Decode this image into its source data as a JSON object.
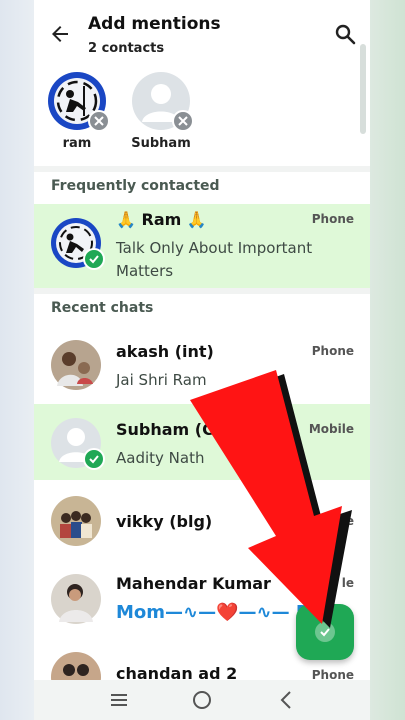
{
  "header": {
    "title": "Add mentions",
    "subtitle": "2 contacts",
    "back_icon": "arrow-left-icon",
    "search_icon": "search-icon"
  },
  "selected": [
    {
      "name": "ram"
    },
    {
      "name": "Subham"
    }
  ],
  "sections": {
    "frequent": "Frequently contacted",
    "recent": "Recent chats"
  },
  "frequent": [
    {
      "name": "🙏 Ram 🙏",
      "status_line1": "Talk Only About Important",
      "status_line2": "Matters",
      "label": "Phone"
    }
  ],
  "recent": [
    {
      "name": "akash (int)",
      "status": "Jai Shri Ram",
      "label": "Phone"
    },
    {
      "name": "Subham (C",
      "status": "Aadity Nath",
      "label": "Mobile"
    },
    {
      "name": "vikky (blg)",
      "status": "",
      "label": "Phone"
    },
    {
      "name": "Mahendar Kumar",
      "status": "Mom—∿—❤️—∿— Da",
      "label": "le"
    },
    {
      "name": "chandan ad 2",
      "status": "",
      "label": "Phone"
    }
  ],
  "colors": {
    "accent": "#1fa855",
    "selected_row": "#dff9d8",
    "annotation_arrow": "#ff1a1a"
  },
  "navbar": {
    "recents_icon": "recents-icon",
    "home_icon": "home-icon",
    "back_icon": "back-nav-icon"
  }
}
